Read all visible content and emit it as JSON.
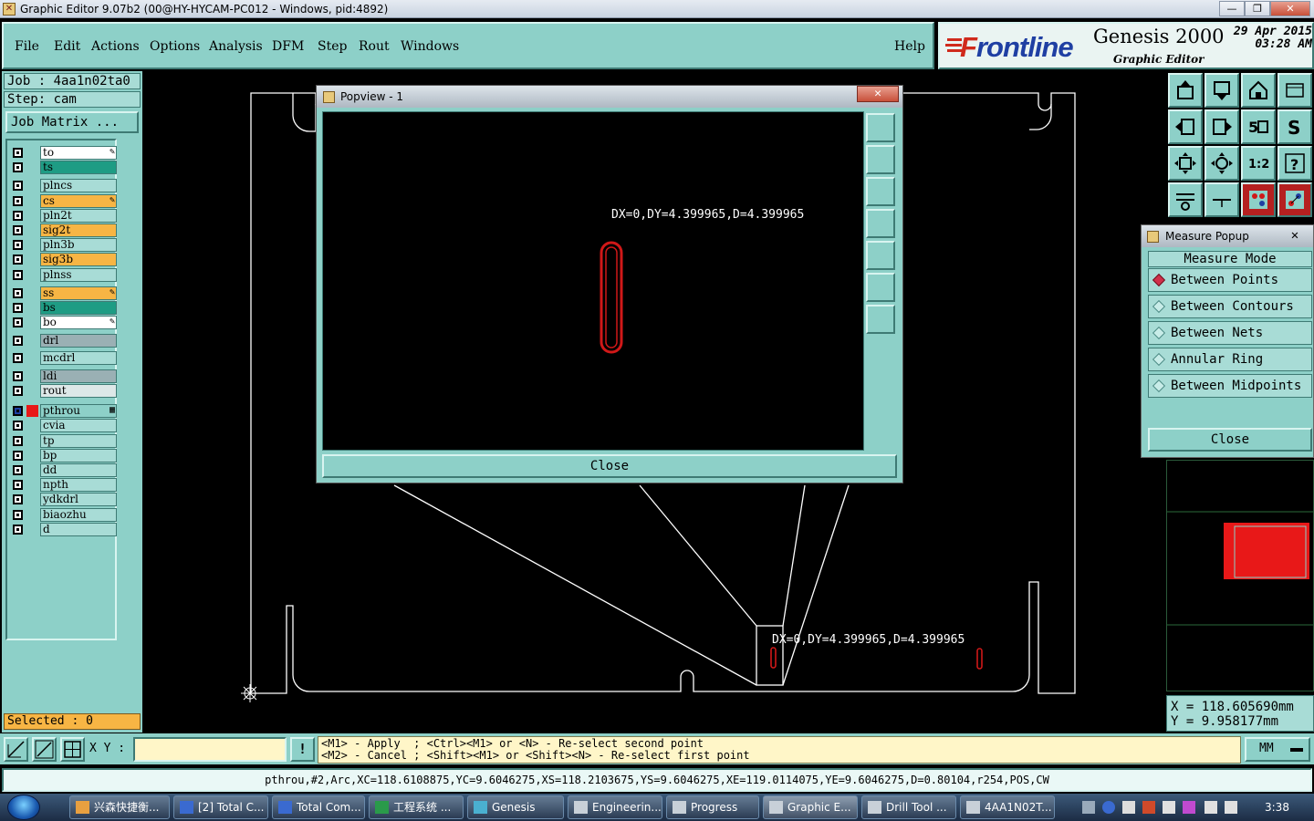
{
  "titlebar": {
    "title": "Graphic Editor 9.07b2 (00@HY-HYCAM-PC012 - Windows, pid:4892)",
    "minimize": "—",
    "restore": "❐",
    "close": "✕"
  },
  "menu": {
    "items": [
      "File",
      "Edit",
      "Actions",
      "Options",
      "Analysis",
      "DFM",
      "Step",
      "Rout",
      "Windows"
    ],
    "help": "Help"
  },
  "logo": {
    "brand_f": "F",
    "brand_rest": "rontline",
    "product": "Genesis 2000",
    "subtitle": "Graphic Editor",
    "date": "29 Apr 2015",
    "time": "03:28 AM"
  },
  "job": {
    "job_label": "Job  : 4aa1n02ta0",
    "step_label": "Step: cam",
    "matrix_button": "Job Matrix ..."
  },
  "layers": [
    {
      "name": "to",
      "color": "#ffffff",
      "mark": "✎"
    },
    {
      "name": "ts",
      "color": "#1e9c84",
      "mark": ""
    },
    {
      "name": "plncs",
      "color": "#a8dcd6",
      "mark": ""
    },
    {
      "name": "cs",
      "color": "#f7b544",
      "mark": "✎"
    },
    {
      "name": "pln2t",
      "color": "#a8dcd6",
      "mark": ""
    },
    {
      "name": "sig2t",
      "color": "#f7b544",
      "mark": ""
    },
    {
      "name": "pln3b",
      "color": "#a8dcd6",
      "mark": ""
    },
    {
      "name": "sig3b",
      "color": "#f7b544",
      "mark": ""
    },
    {
      "name": "plnss",
      "color": "#a8dcd6",
      "mark": ""
    },
    {
      "name": "ss",
      "color": "#f7b544",
      "mark": "✎"
    },
    {
      "name": "bs",
      "color": "#1e9c84",
      "mark": ""
    },
    {
      "name": "bo",
      "color": "#ffffff",
      "mark": "✎"
    },
    {
      "name": "drl",
      "color": "#9ab0b4",
      "mark": ""
    },
    {
      "name": "mcdrl",
      "color": "#a8dcd6",
      "mark": ""
    },
    {
      "name": "ldi",
      "color": "#9ab0b4",
      "mark": ""
    },
    {
      "name": "rout",
      "color": "#dde8e8",
      "mark": ""
    },
    {
      "name": "pthrou",
      "color": "#8dd0c8",
      "mark": "▦"
    },
    {
      "name": "cvia",
      "color": "#a8dcd6",
      "mark": ""
    },
    {
      "name": "tp",
      "color": "#a8dcd6",
      "mark": ""
    },
    {
      "name": "bp",
      "color": "#a8dcd6",
      "mark": ""
    },
    {
      "name": "dd",
      "color": "#a8dcd6",
      "mark": ""
    },
    {
      "name": "npth",
      "color": "#a8dcd6",
      "mark": ""
    },
    {
      "name": "ydkdrl",
      "color": "#a8dcd6",
      "mark": ""
    },
    {
      "name": "biaozhu",
      "color": "#a8dcd6",
      "mark": ""
    },
    {
      "name": "d",
      "color": "#a8dcd6",
      "mark": ""
    }
  ],
  "selected": "Selected : 0",
  "measure": {
    "title": "Measure Popup",
    "close_x": "✕",
    "header": "Measure Mode",
    "modes": [
      "Between Points",
      "Between Contours",
      "Between Nets",
      "Annular Ring",
      "Between Midpoints"
    ],
    "selected_mode": "Between Points",
    "close": "Close"
  },
  "popview": {
    "title": "Popview - 1",
    "close_x": "✕",
    "measurement": "DX=0,DY=4.399965,D=4.399965",
    "close": "Close"
  },
  "canvas": {
    "measurement": "DX=0,DY=4.399965,D=4.399965"
  },
  "coords": {
    "x": "X  =  118.605690mm",
    "y": "Y  =  9.958177mm"
  },
  "cmd": {
    "xy_label": "X Y :",
    "xy_value": "",
    "warn": "!",
    "hint1": "<M1> - Apply  ; <Ctrl><M1> or <N> - Re-select second point",
    "hint2": "<M2> - Cancel ; <Shift><M1> or <Shift><N> - Re-select first point",
    "units": "MM"
  },
  "status": "pthrou,#2,Arc,XC=118.6108875,YC=9.6046275,XS=118.2103675,YS=9.6046275,XE=119.0114075,YE=9.6046275,D=0.80104,r254,POS,CW",
  "taskbar": {
    "tasks": [
      "兴森快捷衡...",
      "[2] Total C...",
      "Total Com...",
      "工程系统    ...",
      "Genesis",
      "Engineerin...",
      "Progress",
      "Graphic E...",
      "Drill Tool ...",
      "4AA1N02T..."
    ],
    "active": "Graphic E...",
    "clock": "3:38"
  },
  "colors": {
    "panel": "#8dd0c8",
    "highlight": "#d01818",
    "outline": "#ffffff",
    "canvas": "#000000"
  }
}
